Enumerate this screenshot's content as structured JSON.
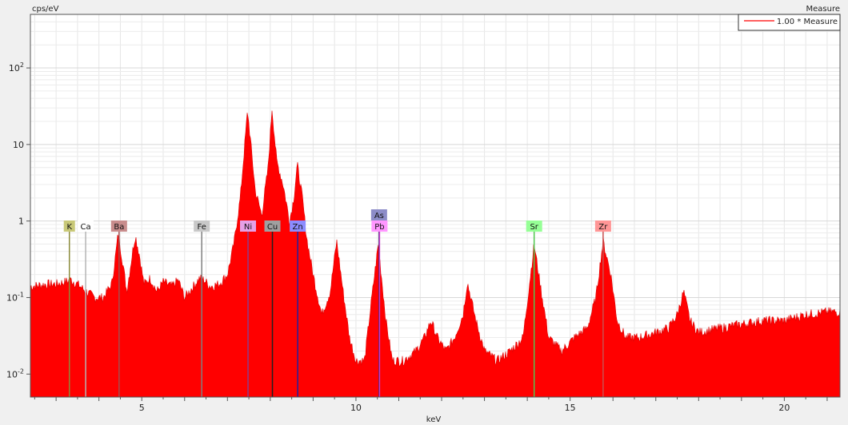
{
  "chart_data": {
    "type": "area",
    "title": "Measure",
    "xlabel": "keV",
    "ylabel": "cps/eV",
    "xlim": [
      2.4,
      21.3
    ],
    "ylim_log10": [
      -2.3,
      2.7
    ],
    "log_y": true,
    "grid": true,
    "legend_position": "top-right",
    "x_ticks": [
      5,
      10,
      15,
      20
    ],
    "y_ticks": [
      {
        "value": 0.01,
        "base": "10",
        "exp": "-2"
      },
      {
        "value": 0.1,
        "base": "10",
        "exp": "-1"
      },
      {
        "value": 1,
        "base": "1",
        "exp": ""
      },
      {
        "value": 10,
        "base": "10",
        "exp": ""
      },
      {
        "value": 100,
        "base": "10",
        "exp": "2"
      }
    ],
    "series": [
      {
        "name": "1.00 * Measure",
        "color": "#ff0000",
        "x": [
          2.4,
          2.8,
          3.0,
          3.2,
          3.35,
          3.5,
          3.7,
          3.9,
          4.1,
          4.3,
          4.4,
          4.45,
          4.55,
          4.65,
          4.8,
          4.85,
          4.95,
          5.05,
          5.2,
          5.35,
          5.5,
          5.7,
          5.85,
          6.0,
          6.2,
          6.35,
          6.45,
          6.6,
          6.8,
          7.0,
          7.15,
          7.3,
          7.47,
          7.65,
          7.8,
          7.95,
          8.04,
          8.15,
          8.3,
          8.45,
          8.55,
          8.63,
          8.75,
          8.85,
          9.0,
          9.2,
          9.4,
          9.55,
          9.7,
          9.85,
          10.0,
          10.2,
          10.35,
          10.52,
          10.7,
          10.85,
          11.1,
          11.4,
          11.6,
          11.75,
          11.9,
          12.1,
          12.3,
          12.5,
          12.6,
          12.8,
          13.0,
          13.3,
          13.6,
          13.9,
          14.05,
          14.16,
          14.3,
          14.5,
          14.8,
          15.1,
          15.4,
          15.6,
          15.77,
          15.95,
          16.1,
          16.3,
          16.6,
          17.0,
          17.3,
          17.5,
          17.65,
          17.8,
          18.0,
          18.5,
          19.0,
          19.5,
          20.0,
          20.5,
          21.0,
          21.3
        ],
        "y": [
          0.14,
          0.15,
          0.15,
          0.16,
          0.17,
          0.15,
          0.12,
          0.1,
          0.1,
          0.15,
          0.4,
          0.7,
          0.3,
          0.12,
          0.45,
          0.65,
          0.35,
          0.15,
          0.18,
          0.12,
          0.16,
          0.14,
          0.17,
          0.1,
          0.14,
          0.18,
          0.17,
          0.14,
          0.15,
          0.2,
          0.5,
          2.0,
          28,
          2.5,
          1.2,
          5.0,
          30,
          6.0,
          3.0,
          1.0,
          2.0,
          5.5,
          2.0,
          0.6,
          0.2,
          0.06,
          0.12,
          0.55,
          0.12,
          0.03,
          0.015,
          0.015,
          0.08,
          0.5,
          0.05,
          0.015,
          0.015,
          0.02,
          0.03,
          0.05,
          0.03,
          0.02,
          0.03,
          0.06,
          0.16,
          0.05,
          0.02,
          0.015,
          0.02,
          0.03,
          0.15,
          0.5,
          0.15,
          0.03,
          0.02,
          0.03,
          0.04,
          0.1,
          0.55,
          0.2,
          0.05,
          0.03,
          0.03,
          0.035,
          0.04,
          0.06,
          0.12,
          0.05,
          0.035,
          0.04,
          0.045,
          0.05,
          0.05,
          0.06,
          0.065,
          0.065
        ]
      }
    ],
    "element_labels": [
      {
        "symbol": "K",
        "energy": 3.31,
        "color": "#c8c878",
        "line_color": "#8c8c3c"
      },
      {
        "symbol": "Ca",
        "energy": 3.69,
        "color": "#ffffff",
        "line_color": "#b4b4b4"
      },
      {
        "symbol": "Ba",
        "energy": 4.47,
        "color": "#c88c8c",
        "line_color": "#a05050"
      },
      {
        "symbol": "Fe",
        "energy": 6.4,
        "color": "#c8c8c8",
        "line_color": "#808080"
      },
      {
        "symbol": "Ni",
        "energy": 7.48,
        "color": "#e6a0e6",
        "line_color": "#8c3c8c"
      },
      {
        "symbol": "Cu",
        "energy": 8.05,
        "color": "#a0a0a0",
        "line_color": "#202020"
      },
      {
        "symbol": "Zn",
        "energy": 8.64,
        "color": "#8c8cff",
        "line_color": "#2020a0"
      },
      {
        "symbol": "As",
        "energy": 10.54,
        "color": "#8c8cc8",
        "line_color": "#1c1c64",
        "row": 2
      },
      {
        "symbol": "Pb",
        "energy": 10.55,
        "color": "#ff96ff",
        "line_color": "#c83cc8"
      },
      {
        "symbol": "Sr",
        "energy": 14.16,
        "color": "#96ff96",
        "line_color": "#50c850"
      },
      {
        "symbol": "Zr",
        "energy": 15.77,
        "color": "#ff9696",
        "line_color": "#c85050"
      }
    ]
  }
}
